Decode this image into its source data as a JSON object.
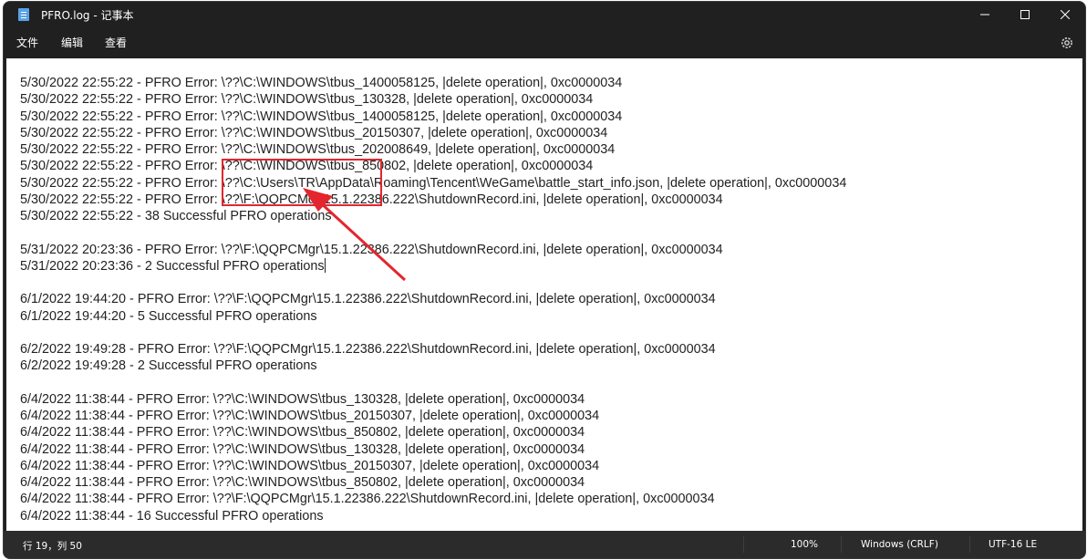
{
  "window": {
    "title": "PFRO.log - 记事本",
    "controls": {
      "minimize": "minimize-icon",
      "maximize": "maximize-icon",
      "close": "close-icon"
    }
  },
  "menu": {
    "file": "文件",
    "edit": "编辑",
    "view": "查看",
    "settings_icon": "gear-icon"
  },
  "editor": {
    "lines": [
      "5/30/2022 22:55:22 - PFRO Error: \\??\\C:\\WINDOWS\\tbus_1400058125, |delete operation|, 0xc0000034",
      "5/30/2022 22:55:22 - PFRO Error: \\??\\C:\\WINDOWS\\tbus_130328, |delete operation|, 0xc0000034",
      "5/30/2022 22:55:22 - PFRO Error: \\??\\C:\\WINDOWS\\tbus_1400058125, |delete operation|, 0xc0000034",
      "5/30/2022 22:55:22 - PFRO Error: \\??\\C:\\WINDOWS\\tbus_20150307, |delete operation|, 0xc0000034",
      "5/30/2022 22:55:22 - PFRO Error: \\??\\C:\\WINDOWS\\tbus_202008649, |delete operation|, 0xc0000034",
      "5/30/2022 22:55:22 - PFRO Error: \\??\\C:\\WINDOWS\\tbus_850802, |delete operation|, 0xc0000034",
      "5/30/2022 22:55:22 - PFRO Error: \\??\\C:\\Users\\TR\\AppData\\Roaming\\Tencent\\WeGame\\battle_start_info.json, |delete operation|, 0xc0000034",
      "5/30/2022 22:55:22 - PFRO Error: \\??\\F:\\QQPCMgr\\15.1.22386.222\\ShutdownRecord.ini, |delete operation|, 0xc0000034",
      "5/30/2022 22:55:22 - 38 Successful PFRO operations",
      "",
      "5/31/2022 20:23:36 - PFRO Error: \\??\\F:\\QQPCMgr\\15.1.22386.222\\ShutdownRecord.ini, |delete operation|, 0xc0000034",
      "5/31/2022 20:23:36 - 2 Successful PFRO operations",
      "",
      "6/1/2022 19:44:20 - PFRO Error: \\??\\F:\\QQPCMgr\\15.1.22386.222\\ShutdownRecord.ini, |delete operation|, 0xc0000034",
      "6/1/2022 19:44:20 - 5 Successful PFRO operations",
      "",
      "6/2/2022 19:49:28 - PFRO Error: \\??\\F:\\QQPCMgr\\15.1.22386.222\\ShutdownRecord.ini, |delete operation|, 0xc0000034",
      "6/2/2022 19:49:28 - 2 Successful PFRO operations",
      "",
      "6/4/2022 11:38:44 - PFRO Error: \\??\\C:\\WINDOWS\\tbus_130328, |delete operation|, 0xc0000034",
      "6/4/2022 11:38:44 - PFRO Error: \\??\\C:\\WINDOWS\\tbus_20150307, |delete operation|, 0xc0000034",
      "6/4/2022 11:38:44 - PFRO Error: \\??\\C:\\WINDOWS\\tbus_850802, |delete operation|, 0xc0000034",
      "6/4/2022 11:38:44 - PFRO Error: \\??\\C:\\WINDOWS\\tbus_130328, |delete operation|, 0xc0000034",
      "6/4/2022 11:38:44 - PFRO Error: \\??\\C:\\WINDOWS\\tbus_20150307, |delete operation|, 0xc0000034",
      "6/4/2022 11:38:44 - PFRO Error: \\??\\C:\\WINDOWS\\tbus_850802, |delete operation|, 0xc0000034",
      "6/4/2022 11:38:44 - PFRO Error: \\??\\F:\\QQPCMgr\\15.1.22386.222\\ShutdownRecord.ini, |delete operation|, 0xc0000034",
      "6/4/2022 11:38:44 - 16 Successful PFRO operations"
    ]
  },
  "annotation": {
    "box_color": "#e3262e",
    "arrow_color": "#e3262e"
  },
  "status": {
    "position": "行 19，列 50",
    "zoom": "100%",
    "line_endings": "Windows (CRLF)",
    "encoding": "UTF-16 LE"
  }
}
